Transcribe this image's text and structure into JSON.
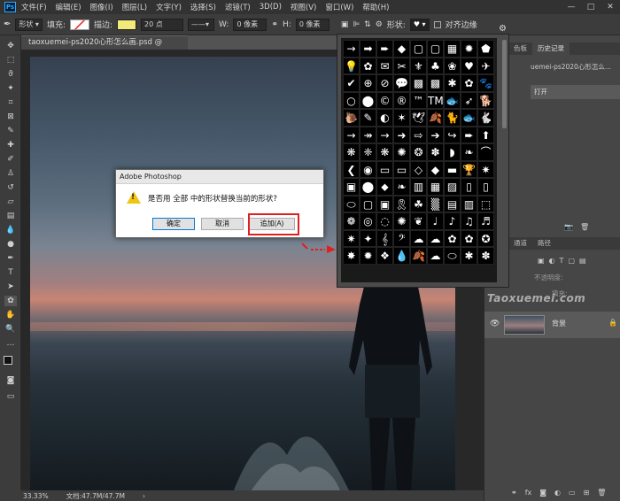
{
  "app": {
    "logo": "Ps",
    "menu": [
      "文件(F)",
      "编辑(E)",
      "图像(I)",
      "图层(L)",
      "文字(Y)",
      "选择(S)",
      "滤镜(T)",
      "3D(D)",
      "视图(V)",
      "窗口(W)",
      "帮助(H)"
    ],
    "window_controls": [
      "—",
      "□",
      "✕"
    ]
  },
  "options": {
    "mode": "形状",
    "fill_label": "填充:",
    "stroke_label": "描边:",
    "stroke_size": "20 点",
    "w_label": "W:",
    "w_value": "0 像素",
    "h_label": "H:",
    "h_value": "0 像素",
    "shape_label": "形状:",
    "align_edges": "对齐边缘"
  },
  "document": {
    "tab_title": "taoxuemei-ps2020心形怎么画.psd @ 33.3%(RGB/8) *",
    "tab_close": "×"
  },
  "status": {
    "zoom": "33.33%",
    "doc_size": "文档:47.7M/47.7M"
  },
  "panels": {
    "history_tabs": [
      "颜色",
      "色板",
      "历史记录"
    ],
    "history_doc": "uemei-ps2020心形怎么...",
    "history_item": "打开",
    "layers_tabs": [
      "图层",
      "通道",
      "路径"
    ],
    "opacity_label": "不透明度:",
    "fill_label": "填充:",
    "layer_name": "背景",
    "lock": "🔒"
  },
  "watermark": "Taoxuemei.com",
  "dialog": {
    "title": "Adobe Photoshop",
    "message": "是否用 全部 中的形状替换当前的形状?",
    "ok": "确定",
    "cancel": "取消",
    "append": "追加(A)"
  },
  "shapes": [
    "→",
    "➡",
    "➨",
    "◆",
    "▢",
    "▢",
    "▦",
    "✹",
    "⬟",
    "💡",
    "✿",
    "✉",
    "✂",
    "⚜",
    "♣",
    "❀",
    "♥",
    "✈",
    "✔",
    "⊕",
    "⊘",
    "💬",
    "▩",
    "▩",
    "✱",
    "✿",
    "🐾",
    "○",
    "⬤",
    "©",
    "®",
    "™",
    "TM",
    "🐟",
    "➶",
    "🐕",
    "🐌",
    "✎",
    "◐",
    "✶",
    "🕊",
    "🍂",
    "🐈",
    "🐟",
    "🐇",
    "→",
    "↠",
    "→",
    "➜",
    "⇨",
    "➔",
    "↪",
    "➨",
    "⬆",
    "❋",
    "❈",
    "❋",
    "✺",
    "❂",
    "✽",
    "◗",
    "❧",
    "⌒",
    "❮",
    "◉",
    "▭",
    "▭",
    "◇",
    "◆",
    "▬",
    "🏆",
    "✷",
    "▣",
    "⬤",
    "⬥",
    "❧",
    "▥",
    "▦",
    "▨",
    "▯",
    "▯",
    "⬭",
    "▢",
    "▣",
    "🎗",
    "☘",
    "▒",
    "▤",
    "▥",
    "⬚",
    "❁",
    "◎",
    "◌",
    "✺",
    "❦",
    "♩",
    "♪",
    "♫",
    "♬",
    "✷",
    "✦",
    "𝄞",
    "𝄢",
    "☁",
    "☁",
    "✿",
    "✿",
    "✪",
    "✸",
    "✹",
    "❖",
    "💧",
    "🍂",
    "☁",
    "⬭",
    "✱",
    "✽"
  ]
}
